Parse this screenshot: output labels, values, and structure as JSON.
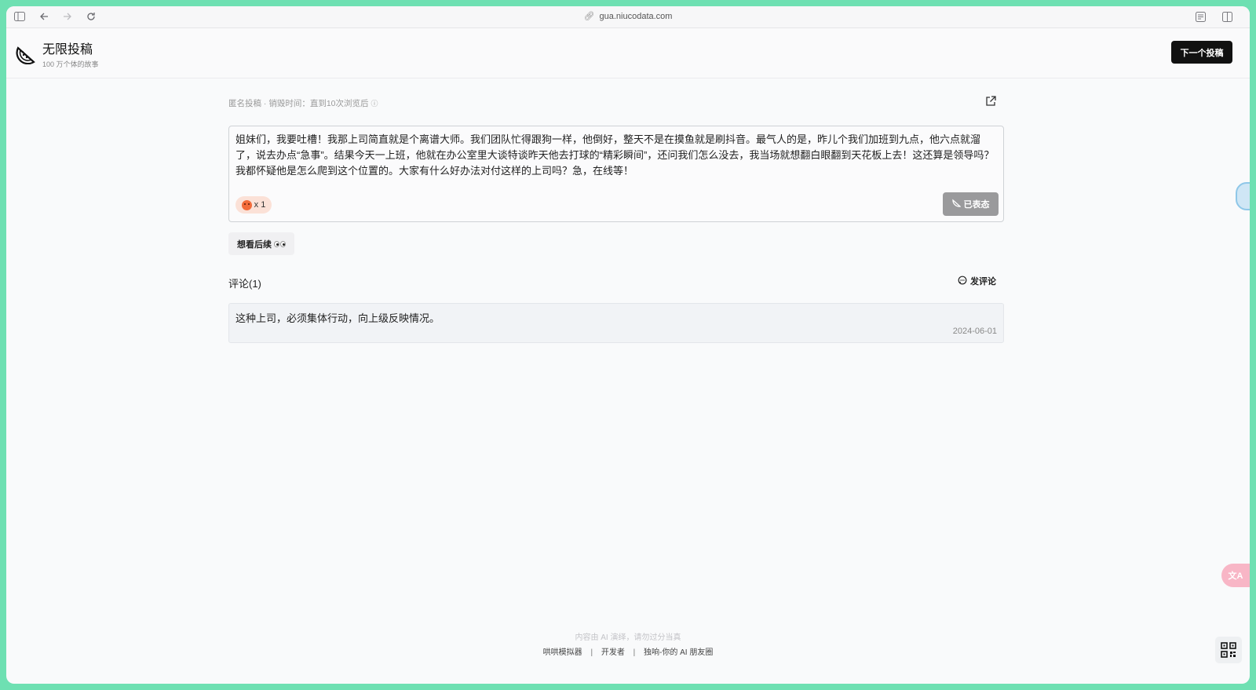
{
  "browser": {
    "url": "gua.niucodata.com"
  },
  "header": {
    "title": "无限投稿",
    "subtitle": "100 万个体的故事",
    "next_button": "下一个投稿"
  },
  "post": {
    "meta": "匿名投稿 · 销毁时间：直到10次浏览后",
    "text": "姐妹们，我要吐槽！我那上司简直就是个离谱大师。我们团队忙得跟狗一样，他倒好，整天不是在摸鱼就是刷抖音。最气人的是，昨儿个我们加班到九点，他六点就溜了，说去办点“急事”。结果今天一上班，他就在办公室里大谈特谈昨天他去打球的“精彩瞬间”，还问我们怎么没去，我当场就想翻白眼翻到天花板上去！这还算是领导吗？我都怀疑他是怎么爬到这个位置的。大家有什么好办法对付这样的上司吗？急，在线等！",
    "reaction_count": "x 1",
    "reacted_label": "已表态",
    "follow_label": "想看后续"
  },
  "comments": {
    "title": "评论(1)",
    "add_label": "发评论",
    "items": [
      {
        "text": "这种上司，必须集体行动，向上级反映情况。",
        "date": "2024-06-01"
      }
    ]
  },
  "footer": {
    "note": "内容由 AI 演绎，请勿过分当真",
    "links": [
      "哄哄模拟器",
      "开发者",
      "独响-你的 AI 朋友圈"
    ]
  },
  "floating": {
    "translate_label": "文A"
  },
  "colors": {
    "frame": "#6ee0b2",
    "primary_button": "#111111",
    "reacted_button": "#9a9a9c",
    "reaction_bg": "#fbe1d7"
  }
}
